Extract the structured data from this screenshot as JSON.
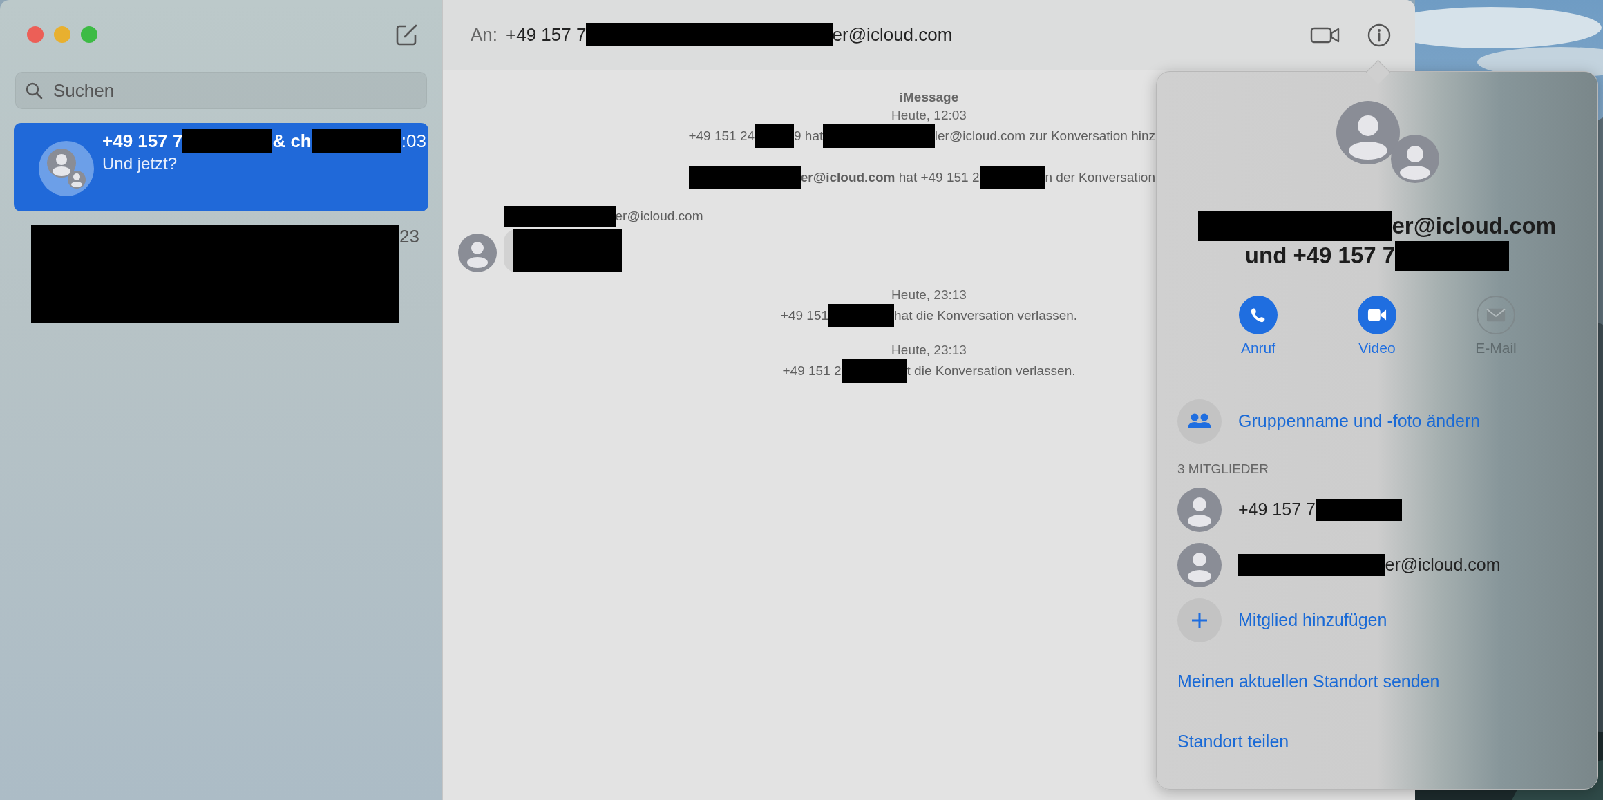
{
  "window": {
    "controls": [
      {
        "kind": "close"
      },
      {
        "kind": "minimize"
      },
      {
        "kind": "zoom"
      }
    ]
  },
  "sidebar": {
    "search": {
      "placeholder": "Suchen"
    },
    "conversations": [
      {
        "selected": true,
        "kind": "chat",
        "title": [
          {
            "kind": "text",
            "text": "+49 157 7"
          },
          {
            "kind": "bar_m"
          },
          {
            "kind": "text",
            "text": "& ch"
          },
          {
            "kind": "bar_m"
          }
        ],
        "time": ":03",
        "preview": "Und jetzt?"
      },
      {
        "selected": false,
        "kind": "redacted",
        "time": "23"
      }
    ]
  },
  "header": {
    "to_label": "An:",
    "recipients": [
      {
        "kind": "text",
        "text": "+49 157 7"
      },
      {
        "kind": "bar_xl"
      },
      {
        "kind": "text",
        "text": "er@icloud.com"
      }
    ]
  },
  "messages": [
    {
      "kind": "service",
      "text": "iMessage"
    },
    {
      "kind": "timestamp",
      "text": "Heute, 12:03"
    },
    {
      "kind": "event_clipped",
      "parts": [
        {
          "kind": "text",
          "text": "+49 151 24"
        },
        {
          "kind": "bar_s"
        },
        {
          "kind": "text",
          "text": "9 hat"
        },
        {
          "kind": "bar_l"
        },
        {
          "kind": "text",
          "text": "ler@icloud.com zur Konversation hinz"
        }
      ]
    },
    {
      "kind": "event_clipped",
      "parts": [
        {
          "kind": "bar_l"
        },
        {
          "kind": "text",
          "text": "**er@icloud.com** hat +49 151 2"
        },
        {
          "kind": "bar_m"
        },
        {
          "kind": "text",
          "text": "n der Konversation"
        }
      ]
    },
    {
      "kind": "incoming",
      "sender": [
        {
          "kind": "bar_l"
        },
        {
          "kind": "text",
          "text": "er@icloud.com"
        }
      ]
    },
    {
      "kind": "timestamp",
      "text": "Heute, 23:13"
    },
    {
      "kind": "event",
      "parts": [
        {
          "kind": "text",
          "text": "+49 151"
        },
        {
          "kind": "bar_m"
        },
        {
          "kind": "text",
          "text": "hat die Konversation verlassen."
        }
      ]
    },
    {
      "kind": "timestamp",
      "text": "Heute, 23:13"
    },
    {
      "kind": "event",
      "parts": [
        {
          "kind": "text",
          "text": "+49 151 2"
        },
        {
          "kind": "bar_m"
        },
        {
          "kind": "text",
          "text": "t die Konversation verlassen."
        }
      ]
    }
  ],
  "details": {
    "name_lines": [
      [
        {
          "kind": "bar_l"
        },
        {
          "kind": "text",
          "text": "er@icloud.com"
        }
      ],
      [
        {
          "kind": "text",
          "text": "und +49 157 7"
        },
        {
          "kind": "bar_m"
        }
      ]
    ],
    "actions": [
      {
        "kind": "call",
        "label": "Anruf",
        "disabled": false
      },
      {
        "kind": "video",
        "label": "Video",
        "disabled": false
      },
      {
        "kind": "mail",
        "label": "E-Mail",
        "disabled": true
      }
    ],
    "group_edit": "Gruppenname und -foto ändern",
    "members_heading": "3 MITGLIEDER",
    "members": [
      {
        "name": [
          {
            "kind": "text",
            "text": "+49 157 7"
          },
          {
            "kind": "bar_m"
          }
        ]
      },
      {
        "name": [
          {
            "kind": "bar_l"
          },
          {
            "kind": "text",
            "text": "er@icloud.com"
          }
        ]
      }
    ],
    "add_member": "Mitglied hinzufügen",
    "links": [
      "Meinen aktuellen Standort senden",
      "Standort teilen"
    ]
  }
}
